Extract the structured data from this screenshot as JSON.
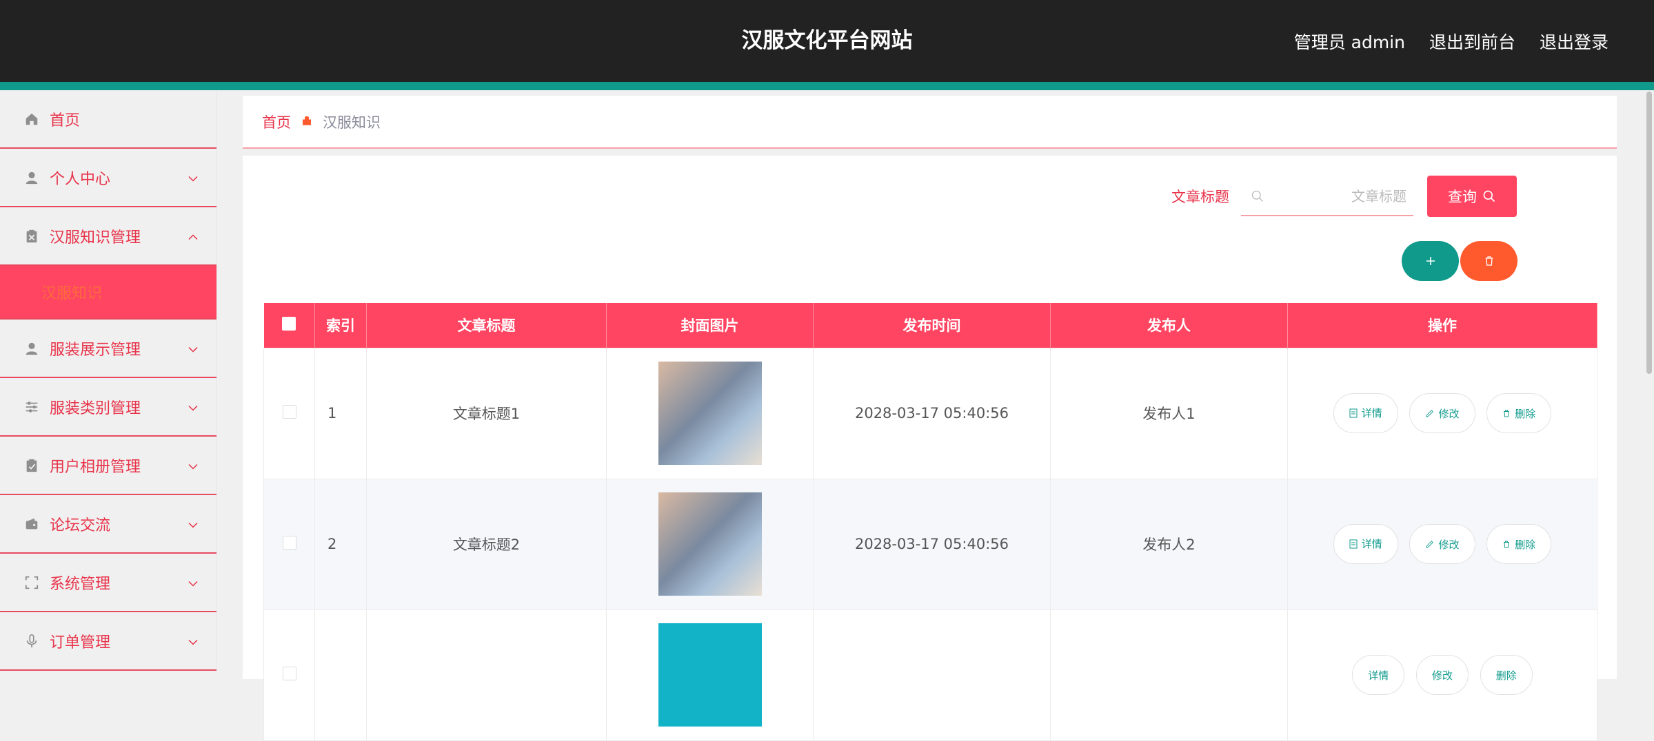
{
  "header": {
    "title": "汉服文化平台网站",
    "admin_label": "管理员 admin",
    "to_front": "退出到前台",
    "logout": "退出登录"
  },
  "sidebar": {
    "items": [
      {
        "label": "首页",
        "icon": "home-icon"
      },
      {
        "label": "个人中心",
        "icon": "user-icon"
      },
      {
        "label": "汉服知识管理",
        "icon": "clipboard-icon"
      },
      {
        "label": "服装展示管理",
        "icon": "user-icon"
      },
      {
        "label": "服装类别管理",
        "icon": "sliders-icon"
      },
      {
        "label": "用户相册管理",
        "icon": "clipboard-icon"
      },
      {
        "label": "论坛交流",
        "icon": "wallet-icon"
      },
      {
        "label": "系统管理",
        "icon": "frame-icon"
      },
      {
        "label": "订单管理",
        "icon": "mic-icon"
      }
    ],
    "active_submenu": "汉服知识"
  },
  "breadcrumb": {
    "home": "首页",
    "current": "汉服知识"
  },
  "search": {
    "label": "文章标题",
    "placeholder": "文章标题",
    "button": "查询"
  },
  "table": {
    "columns": [
      "索引",
      "文章标题",
      "封面图片",
      "发布时间",
      "发布人",
      "操作"
    ],
    "rows": [
      {
        "index": "1",
        "title": "文章标题1",
        "time": "2028-03-17 05:40:56",
        "author": "发布人1"
      },
      {
        "index": "2",
        "title": "文章标题2",
        "time": "2028-03-17 05:40:56",
        "author": "发布人2"
      },
      {
        "index": "",
        "title": "",
        "time": "",
        "author": ""
      }
    ],
    "actions": {
      "detail": "详情",
      "edit": "修改",
      "delete": "删除"
    }
  },
  "colors": {
    "primary": "#ff4562",
    "teal": "#0f9a8c",
    "orange": "#ff5a2d",
    "dark": "#222222"
  }
}
